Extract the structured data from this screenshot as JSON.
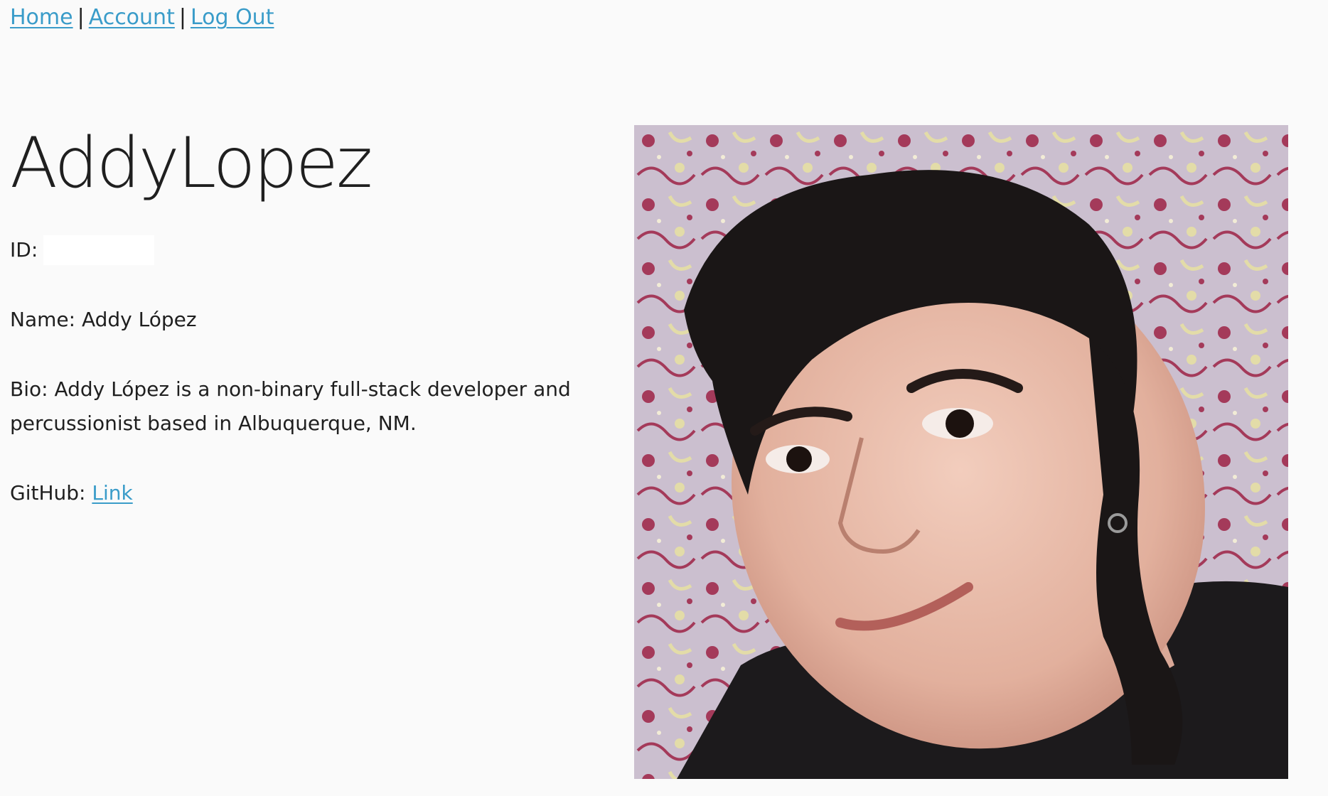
{
  "nav": {
    "home": "Home",
    "separator_1": "|",
    "account": "Account",
    "separator_2": "|",
    "logout": "Log Out"
  },
  "profile": {
    "username": "AddyLopez",
    "id_label": "ID:",
    "name_label": "Name:",
    "name_value": "Addy López",
    "bio_label": "Bio:",
    "bio_value": "Addy López is a non-binary full-stack developer and percussionist based in Albuquerque, NM.",
    "github_label": "GitHub:",
    "github_link": "Link"
  },
  "colors": {
    "link": "#3a9cc9",
    "text": "#1f1f1f",
    "background": "#fafafa"
  }
}
